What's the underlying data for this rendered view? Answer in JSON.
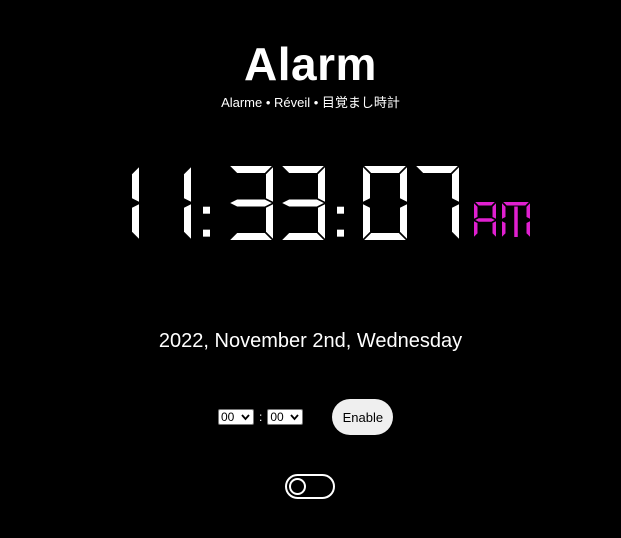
{
  "header": {
    "title": "Alarm",
    "subtitle": "Alarme • Réveil • 目覚まし時計"
  },
  "clock": {
    "hours": "11",
    "minutes": "33",
    "seconds": "07",
    "meridiem": "AM",
    "digit_color": "#ffffff",
    "meridiem_color": "#e020d0"
  },
  "date": {
    "text": "2022, November 2nd, Wednesday"
  },
  "alarm": {
    "hour_value": "00",
    "separator": ":",
    "minute_value": "00",
    "enable_label": "Enable"
  },
  "toggle": {
    "state": "off"
  }
}
